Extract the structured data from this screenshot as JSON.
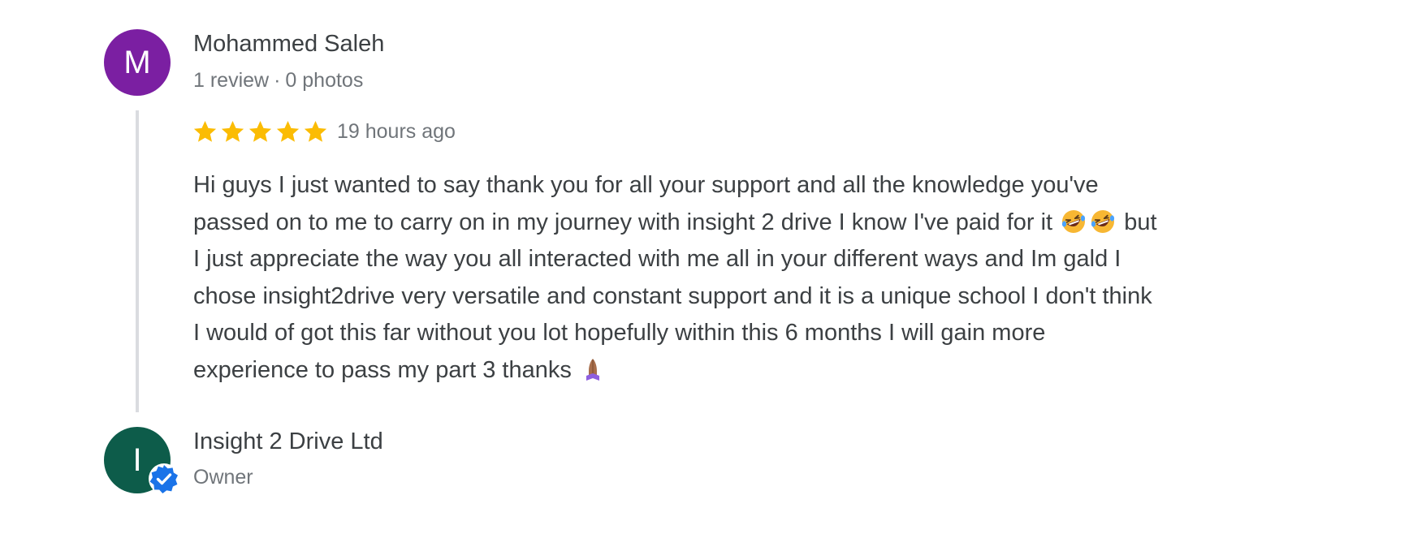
{
  "review": {
    "reviewer": {
      "avatar_letter": "M",
      "avatar_color": "#7b1fa2",
      "name": "Mohammed Saleh",
      "review_count": "1 review",
      "separator": "·",
      "photo_count": "0 photos"
    },
    "rating": 5,
    "max_rating": 5,
    "star_color": "#fbbc04",
    "time_ago": "19 hours ago",
    "text_lines": [
      {
        "text": "Hi guys I just wanted to say thank you for all your support and all the knowledge you've"
      },
      {
        "text": "passed on to me to carry on in my journey with insight 2 drive I know I've paid for it",
        "after": "but",
        "emojis": [
          "rolling-on-floor-laughing-emoji",
          "rolling-on-floor-laughing-emoji"
        ]
      },
      {
        "text": "I just appreciate the way you all interacted with me all in your different ways and Im gald I"
      },
      {
        "text": "chose insight2drive very versatile and constant support and it is a unique school I don't think"
      },
      {
        "text": "I would of got this far without you lot hopefully within this 6 months I will gain more"
      },
      {
        "text": "experience to pass my part 3 thanks",
        "emojis": [
          "folded-hands-emoji"
        ]
      }
    ]
  },
  "owner_reply": {
    "avatar_letter": "I",
    "avatar_color": "#0d5c4a",
    "verified_color": "#1a73e8",
    "name": "Insight 2 Drive Ltd",
    "role": "Owner"
  }
}
